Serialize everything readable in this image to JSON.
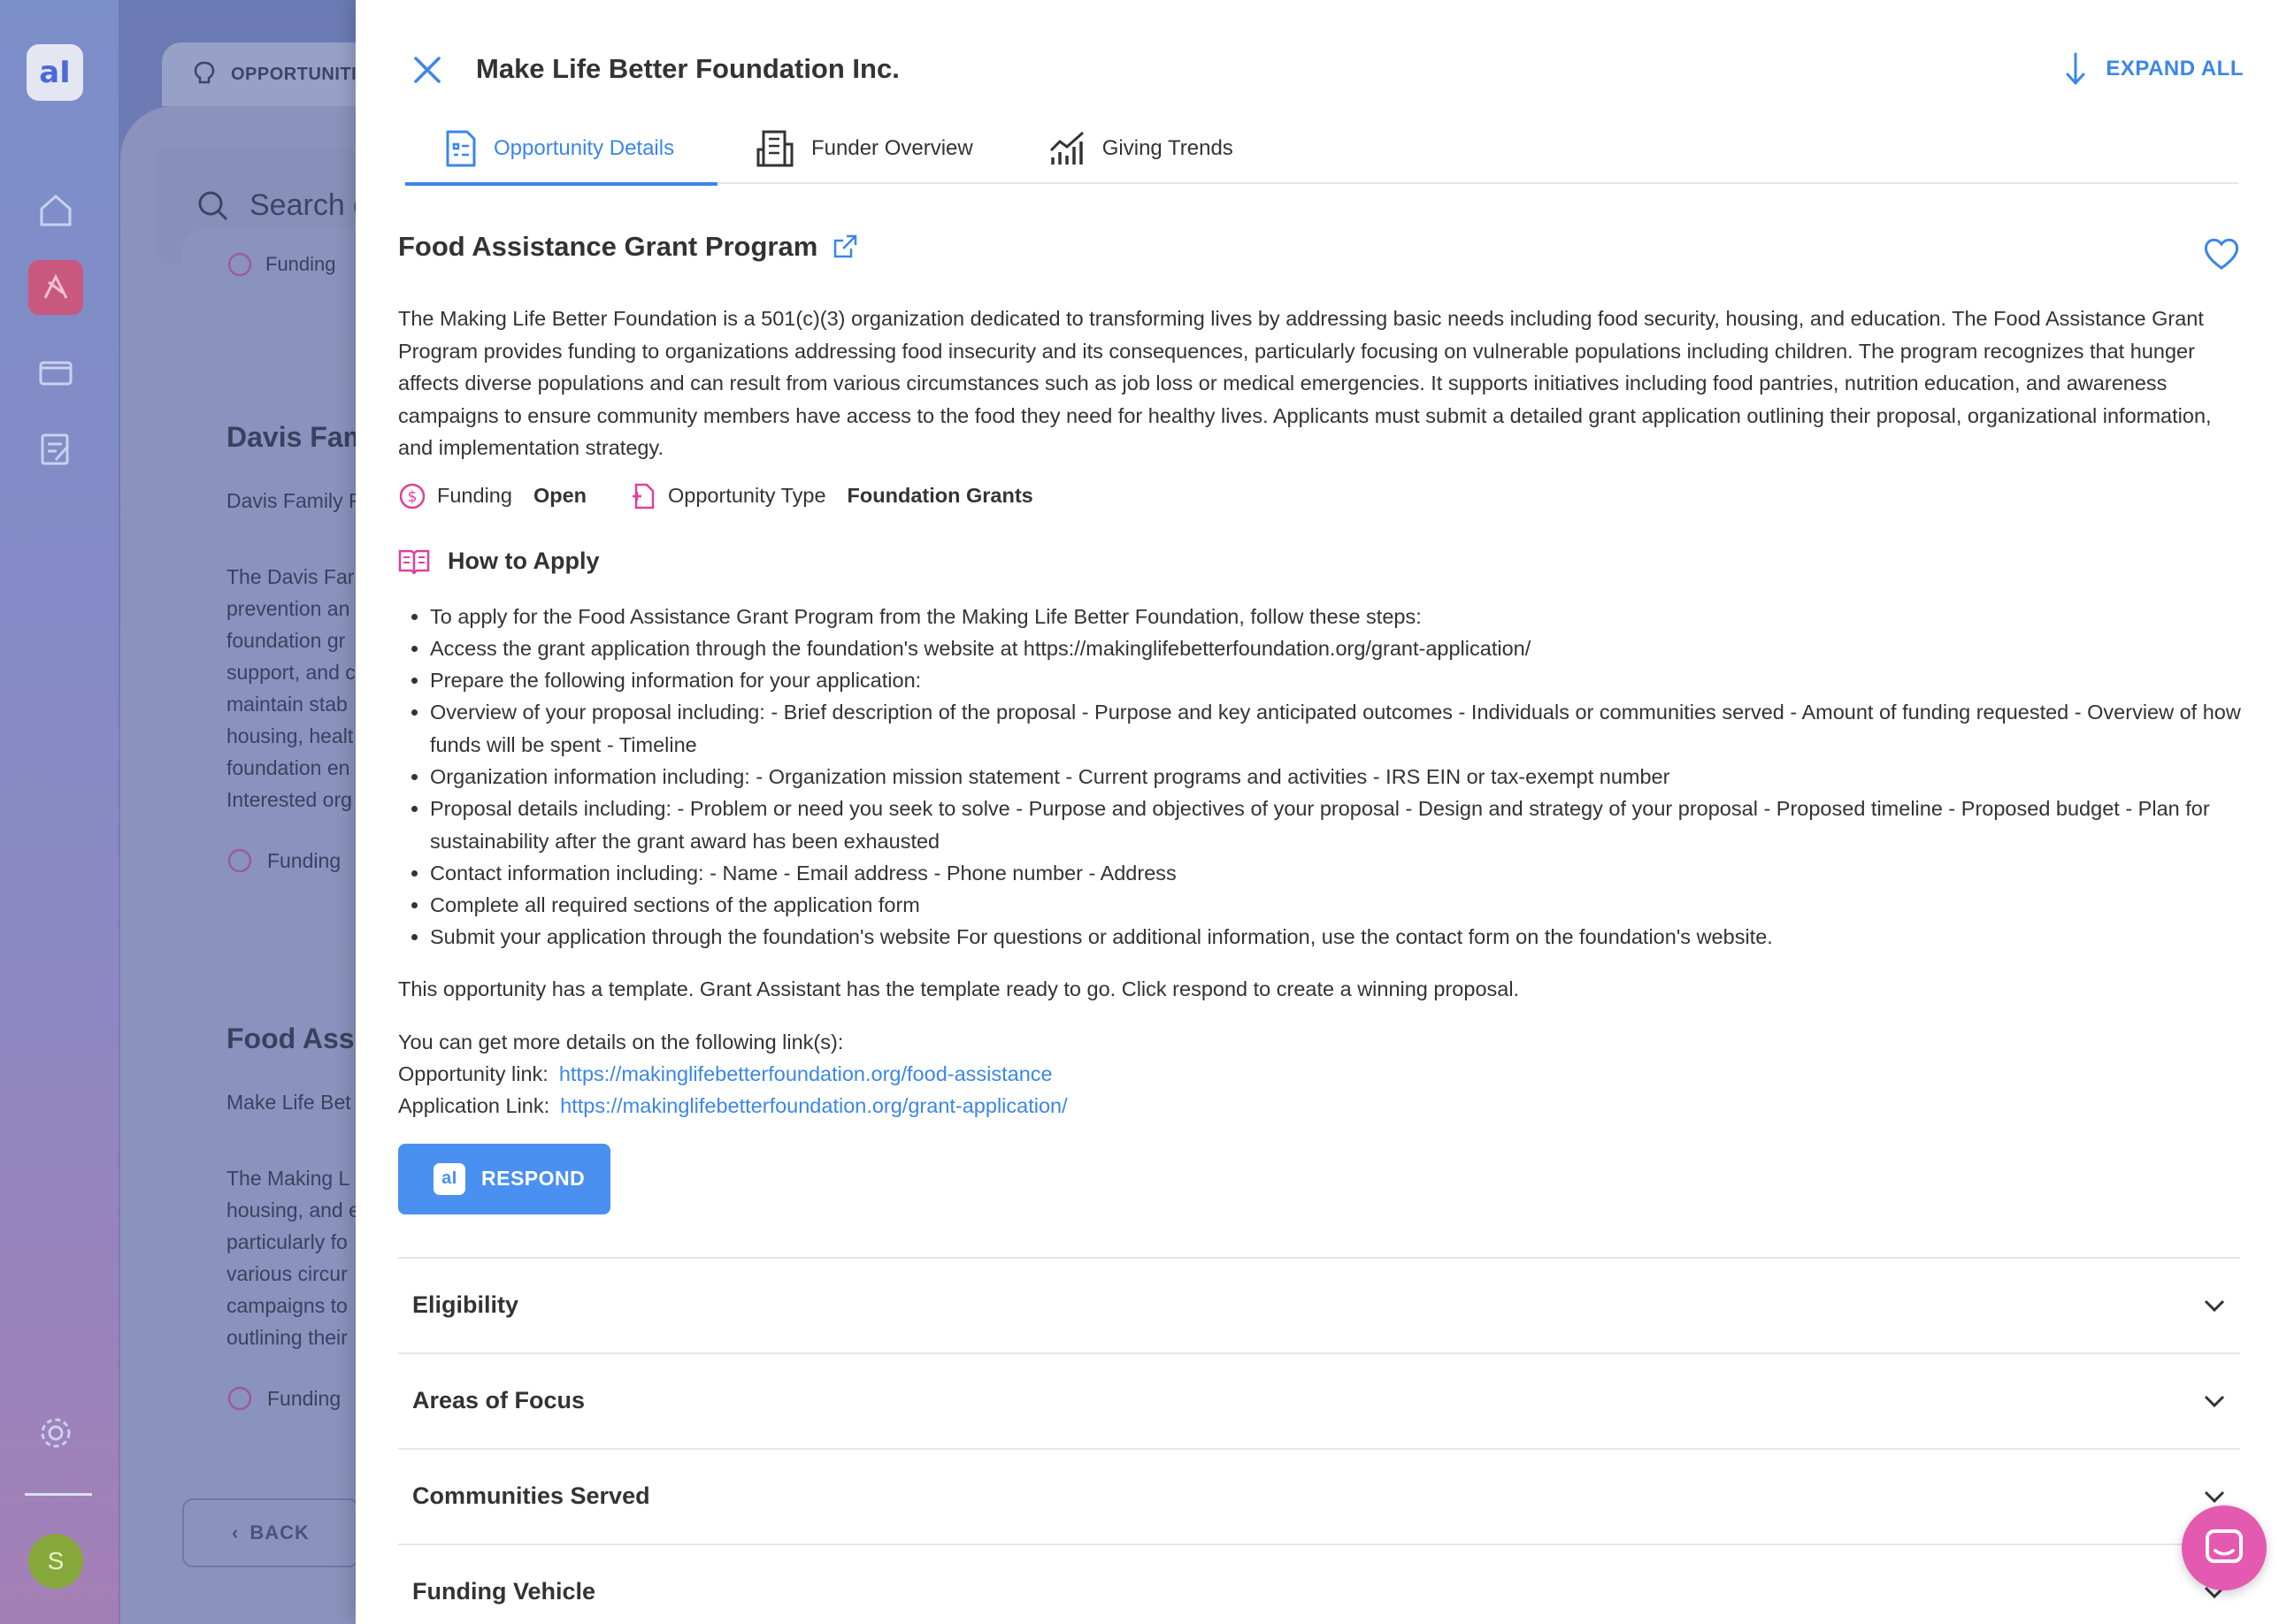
{
  "app": {
    "logo_text": "aI",
    "avatar_initial": "S",
    "bg_tab_label": "OPPORTUNITIE",
    "bg_search_placeholder": "Search o",
    "bg_card_funding_partial": "Funding",
    "bg_cards": [
      {
        "title": "Davis Fam",
        "subtitle": "Davis Family F",
        "body": [
          "The Davis Far",
          "prevention an",
          "foundation gr",
          "support, and c",
          "maintain stab",
          "housing, healt",
          "foundation en",
          "Interested org"
        ],
        "funding": "Funding"
      },
      {
        "title": "Food Assis",
        "subtitle": "Make Life Bet",
        "body": [
          "The Making L",
          "housing, and e",
          "particularly fo",
          "various circur",
          "campaigns to",
          "outlining their"
        ],
        "funding": "Funding"
      }
    ],
    "bg_back": "BACK"
  },
  "drawer": {
    "title": "Make Life Better Foundation Inc.",
    "expand_all": "EXPAND ALL",
    "tabs": [
      {
        "label": "Opportunity Details",
        "icon": "document-list-icon"
      },
      {
        "label": "Funder Overview",
        "icon": "building-icon"
      },
      {
        "label": "Giving Trends",
        "icon": "trend-chart-icon"
      }
    ],
    "opportunity": {
      "title": "Food Assistance Grant Program",
      "description": "The Making Life Better Foundation is a 501(c)(3) organization dedicated to transforming lives by addressing basic needs including food security, housing, and education. The Food Assistance Grant Program provides funding to organizations addressing food insecurity and its consequences, particularly focusing on vulnerable populations including children. The program recognizes that hunger affects diverse populations and can result from various circumstances such as job loss or medical emergencies. It supports initiatives including food pantries, nutrition education, and awareness campaigns to ensure community members have access to the food they need for healthy lives. Applicants must submit a detailed grant application outlining their proposal, organizational information, and implementation strategy.",
      "funding_label": "Funding",
      "funding_value": "Open",
      "type_label": "Opportunity Type",
      "type_value": "Foundation Grants"
    },
    "how_to_apply": {
      "title": "How to Apply",
      "steps": [
        "To apply for the Food Assistance Grant Program from the Making Life Better Foundation, follow these steps:",
        "Access the grant application through the foundation's website at https://makinglifebetterfoundation.org/grant-application/",
        "Prepare the following information for your application:",
        " Overview of your proposal including: - Brief description of the proposal - Purpose and key anticipated outcomes - Individuals or communities served - Amount of funding requested - Overview of how funds will be spent - Timeline",
        "Organization information including: - Organization mission statement - Current programs and activities - IRS EIN or tax-exempt number",
        "Proposal details including: - Problem or need you seek to solve - Purpose and objectives of your proposal - Design and strategy of your proposal - Proposed timeline - Proposed budget - Plan for sustainability after the grant award has been exhausted",
        "Contact information including: - Name - Email address - Phone number - Address",
        "Complete all required sections of the application form",
        "Submit your application through the foundation's website For questions or additional information, use the contact form on the foundation's website."
      ]
    },
    "template_note": "This opportunity has a template. Grant Assistant has the template ready to go. Click respond to create a winning proposal.",
    "links": {
      "intro": "You can get more details on the following link(s):",
      "opportunity_label": "Opportunity link:",
      "opportunity_url": "https://makinglifebetterfoundation.org/food-assistance",
      "application_label": "Application Link:",
      "application_url": "https://makinglifebetterfoundation.org/grant-application/"
    },
    "respond_label": "RESPOND",
    "accordion": [
      "Eligibility",
      "Areas of Focus",
      "Communities Served",
      "Funding Vehicle"
    ]
  },
  "colors": {
    "accent": "#3b86e8",
    "pink_icon": "#e0409a",
    "chat_fab": "#e55ab1"
  }
}
